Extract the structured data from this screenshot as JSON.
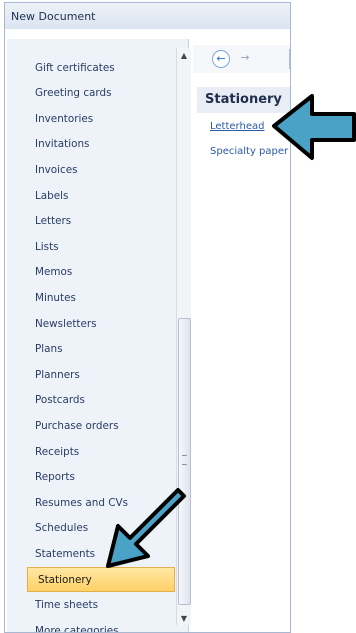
{
  "window": {
    "title": "New Document"
  },
  "categories": [
    {
      "label": "Gift certificates",
      "selected": false
    },
    {
      "label": "Greeting cards",
      "selected": false
    },
    {
      "label": "Inventories",
      "selected": false
    },
    {
      "label": "Invitations",
      "selected": false
    },
    {
      "label": "Invoices",
      "selected": false
    },
    {
      "label": "Labels",
      "selected": false
    },
    {
      "label": "Letters",
      "selected": false
    },
    {
      "label": "Lists",
      "selected": false
    },
    {
      "label": "Memos",
      "selected": false
    },
    {
      "label": "Minutes",
      "selected": false
    },
    {
      "label": "Newsletters",
      "selected": false
    },
    {
      "label": "Plans",
      "selected": false
    },
    {
      "label": "Planners",
      "selected": false
    },
    {
      "label": "Postcards",
      "selected": false
    },
    {
      "label": "Purchase orders",
      "selected": false
    },
    {
      "label": "Receipts",
      "selected": false
    },
    {
      "label": "Reports",
      "selected": false
    },
    {
      "label": "Resumes and CVs",
      "selected": false
    },
    {
      "label": "Schedules",
      "selected": false
    },
    {
      "label": "Statements",
      "selected": false
    },
    {
      "label": "Stationery",
      "selected": true
    },
    {
      "label": "Time sheets",
      "selected": false
    },
    {
      "label": "More categories",
      "selected": false
    }
  ],
  "navigation": {
    "back_icon": "back-arrow-icon",
    "forward_icon": "forward-arrow-icon"
  },
  "right_pane": {
    "heading": "Stationery",
    "links": [
      "Letterhead",
      "Specialty paper"
    ]
  },
  "annotations": {
    "arrow_color": "#4aa3c7"
  },
  "colors": {
    "selected_bg": "#ffd066",
    "link": "#2a5aa8"
  }
}
